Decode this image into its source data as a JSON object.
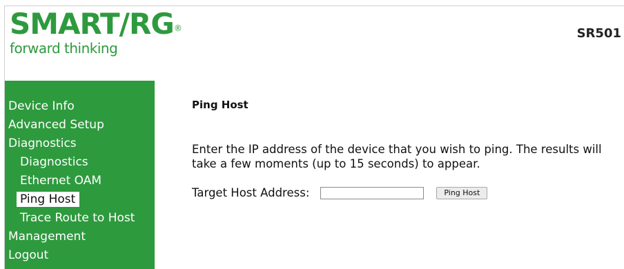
{
  "header": {
    "logo_text": "SMART/RG",
    "logo_mark": "®",
    "tagline": "forward thinking",
    "model": "SR501"
  },
  "sidebar": {
    "items": [
      {
        "label": "Device Info"
      },
      {
        "label": "Advanced Setup"
      },
      {
        "label": "Diagnostics"
      },
      {
        "label": "Diagnostics"
      },
      {
        "label": "Ethernet OAM"
      },
      {
        "label": "Ping Host"
      },
      {
        "label": "Trace Route to Host"
      },
      {
        "label": "Management"
      },
      {
        "label": "Logout"
      }
    ]
  },
  "main": {
    "title": "Ping Host",
    "description": "Enter the IP address of the device that you wish to ping. The results will take a few moments (up to 15 seconds) to appear.",
    "target_label": "Target Host Address:",
    "target_value": "",
    "button_label": "Ping Host"
  },
  "colors": {
    "brand_green": "#2e9a3e",
    "sidebar_text": "#ffffff",
    "active_bg": "#ffffff"
  }
}
